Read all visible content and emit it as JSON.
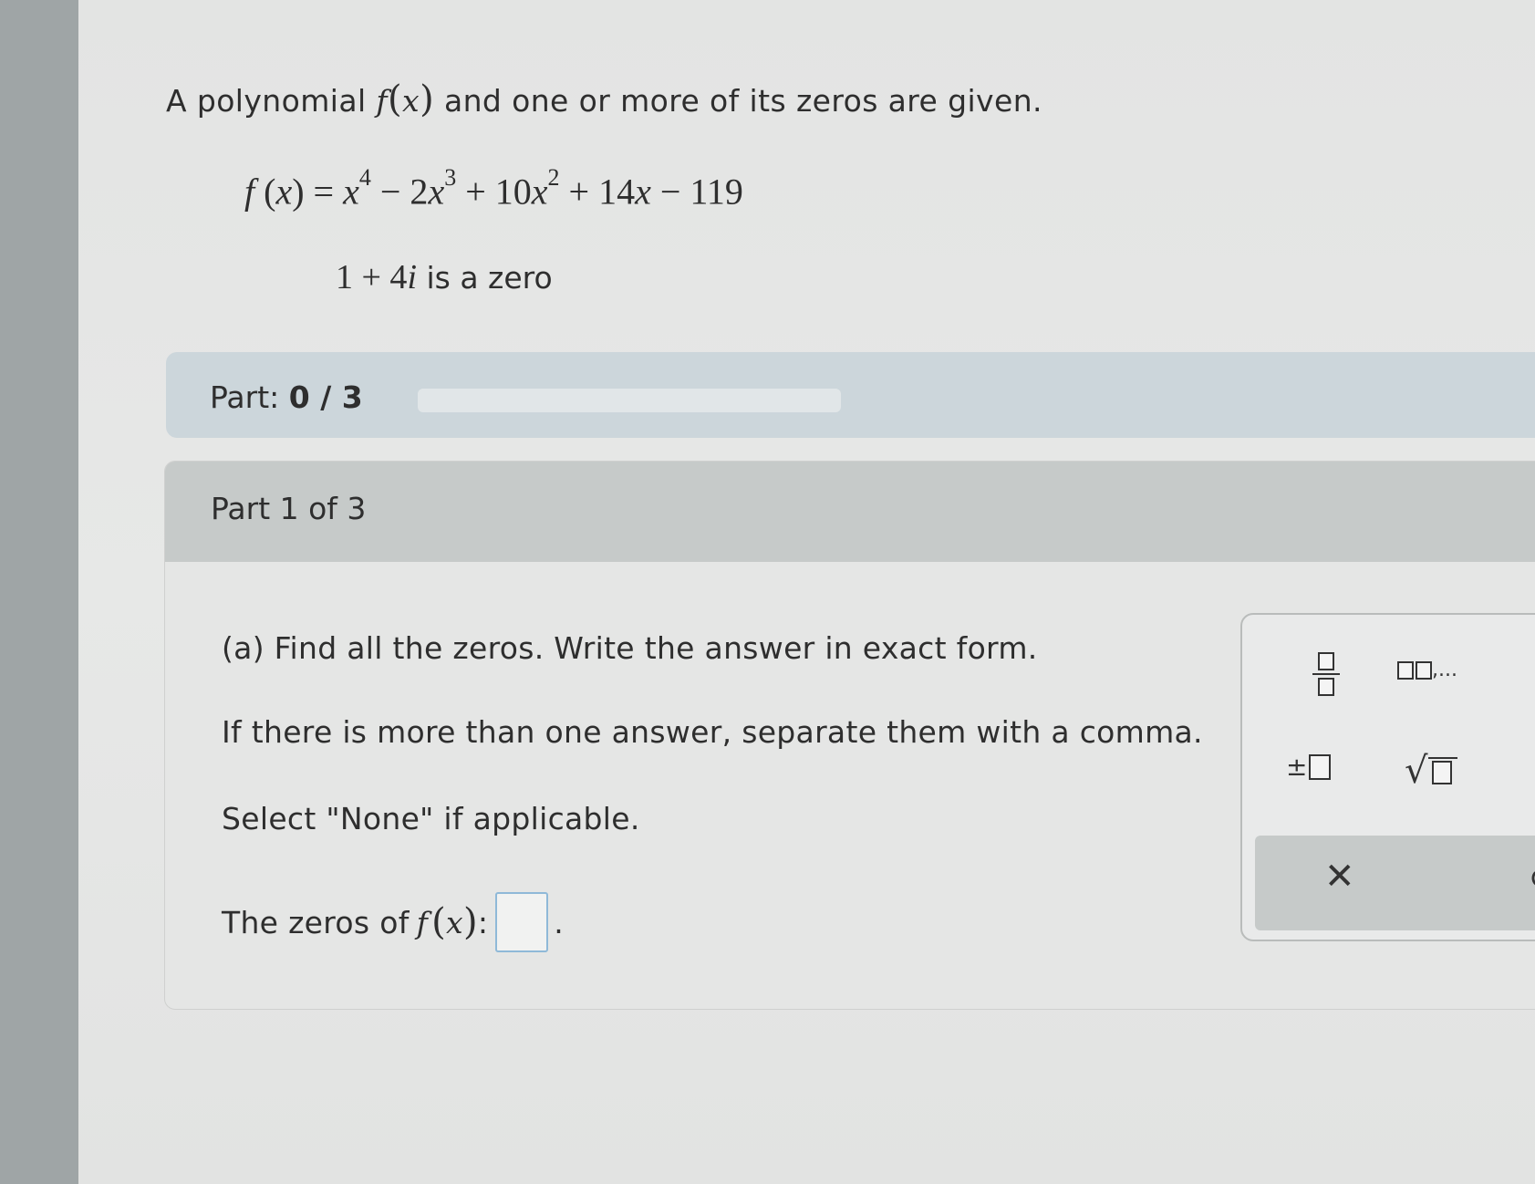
{
  "problem": {
    "intro_before": "A polynomial ",
    "intro_func": "f",
    "intro_arg": "x",
    "intro_after": " and one or more of its zeros are given.",
    "equation": {
      "lhs_f": "f",
      "lhs_x": "x",
      "t1_var": "x",
      "t1_exp": "4",
      "t2_coef": "− 2",
      "t2_var": "x",
      "t2_exp": "3",
      "t3_coef": "+ 10",
      "t3_var": "x",
      "t3_exp": "2",
      "t4_coef": "+ 14",
      "t4_var": "x",
      "t5": "− 119"
    },
    "given_zero_real": "1 + 4",
    "given_zero_imag": "i",
    "given_zero_suffix": " is a zero"
  },
  "progress": {
    "label": "Part: ",
    "value": "0 / 3",
    "fraction": 0
  },
  "part": {
    "title": "Part 1 of 3",
    "question_a": "(a) Find all the zeros. Write the answer in exact form.",
    "instruction_comma": "If there is more than one answer, separate them with a comma.",
    "instruction_none": "Select \"None\" if applicable.",
    "answer_prefix": "The zeros of ",
    "answer_func": "f",
    "answer_arg": "x",
    "answer_colon": ":",
    "answer_value": "",
    "answer_suffix": "."
  },
  "palette": {
    "list_dots": ",...",
    "pm_sign": "±",
    "sqrt_sign": "√",
    "clear_symbol": "✕",
    "undo_symbol": "↺"
  },
  "icons": [
    "fraction-icon",
    "list-icon",
    "plus-minus-icon",
    "square-root-icon",
    "clear-icon",
    "undo-icon"
  ]
}
